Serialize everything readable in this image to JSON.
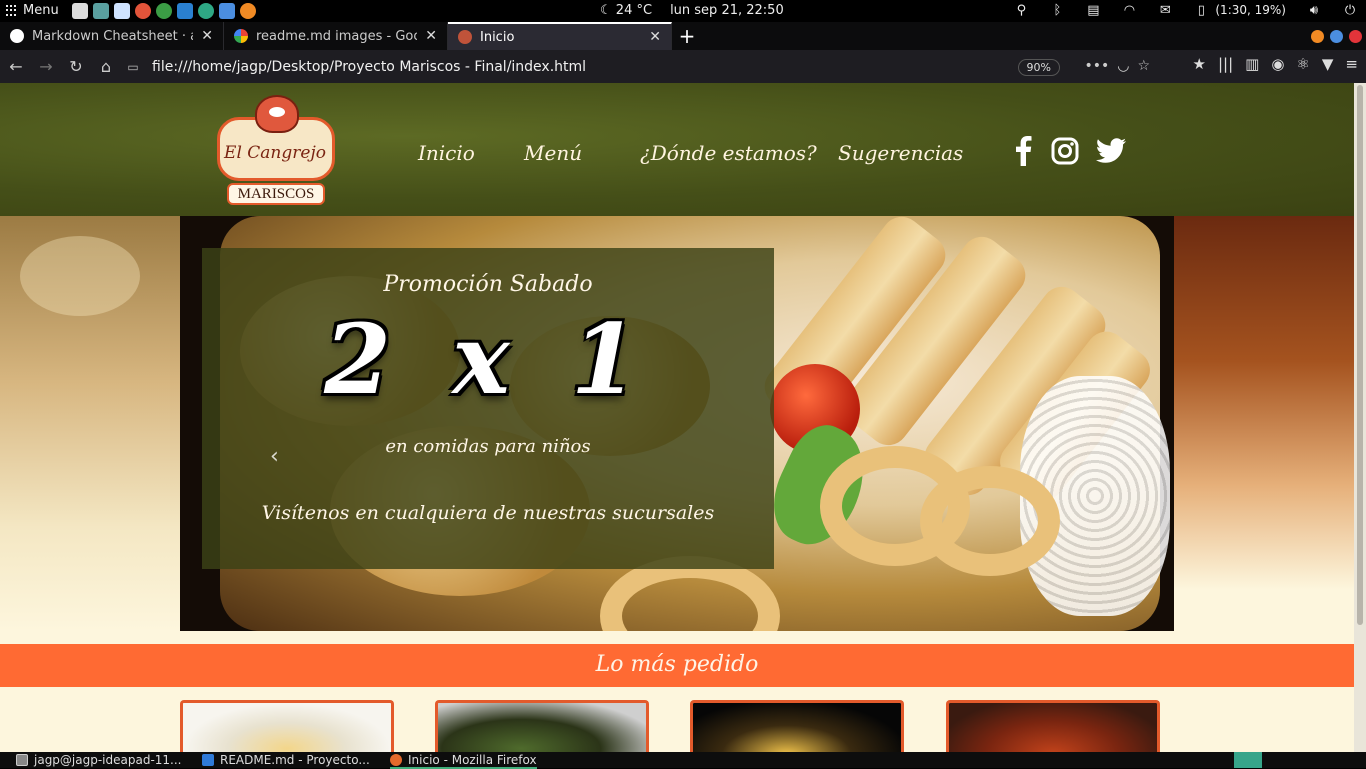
{
  "system": {
    "menu_label": "Menu",
    "weather": "24 °C",
    "datetime": "lun sep 21, 22:50",
    "battery": "(1:30, 19%)"
  },
  "tabs": [
    {
      "title": "Markdown Cheatsheet · ad",
      "favicon_color": "#ffffff",
      "active": false
    },
    {
      "title": "readme.md images - Googl",
      "favicon_color": "#4285f4",
      "active": false
    },
    {
      "title": "Inicio",
      "favicon_color": "#c0533a",
      "active": true
    }
  ],
  "browser": {
    "url": "file:///home/jagp/Desktop/Proyecto Mariscos - Final/index.html",
    "zoom": "90%"
  },
  "site": {
    "logo": {
      "name": "El Cangrejo",
      "sub": "MARISCOS"
    },
    "nav": [
      "Inicio",
      "Menú",
      "¿Dónde estamos?",
      "Sugerencias"
    ],
    "social": [
      "facebook-icon",
      "instagram-icon",
      "twitter-icon"
    ],
    "promo": {
      "title": "Promoción Sabado",
      "big": "2 x 1",
      "sub": "en comidas para niños",
      "visit": "Visítenos en cualquiera de nuestras sucursales"
    },
    "band_title": "Lo más pedido",
    "colors": {
      "header": "#454f18",
      "accent": "#ff6a33",
      "overlay": "#3c4216"
    }
  },
  "taskbar": [
    {
      "label": "jagp@jagp-ideapad-11...",
      "icon_color": "#888888",
      "active": false
    },
    {
      "label": "README.md - Proyecto...",
      "icon_color": "#2f7ad8",
      "active": false
    },
    {
      "label": "Inicio - Mozilla Firefox",
      "icon_color": "#e66a2c",
      "active": true
    }
  ]
}
